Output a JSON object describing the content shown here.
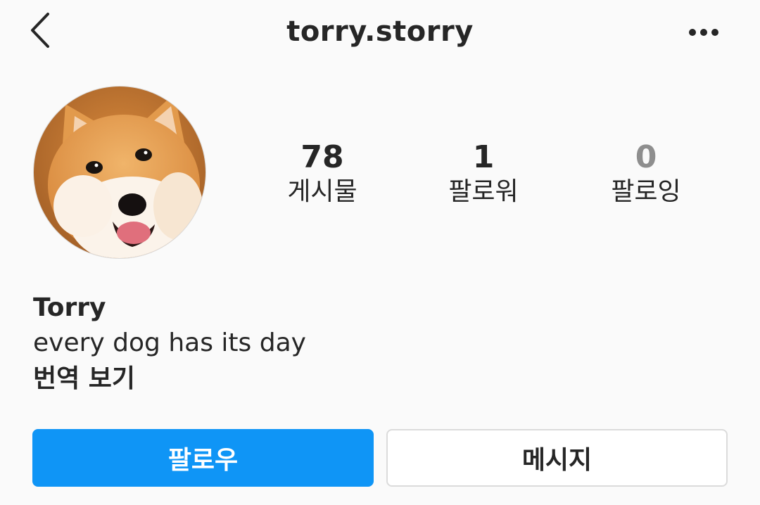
{
  "header": {
    "username": "torry.storry",
    "back_icon": "chevron-left-icon",
    "more_icon": "more-horizontal-icon"
  },
  "profile": {
    "avatar_description": "shiba-inu-dog-photo",
    "stats": {
      "posts": {
        "count": "78",
        "label": "게시물"
      },
      "followers": {
        "count": "1",
        "label": "팔로워"
      },
      "following": {
        "count": "0",
        "label": "팔로잉"
      }
    },
    "name": "Torry",
    "bio": "every dog has its day",
    "translate_label": "번역 보기"
  },
  "actions": {
    "follow_label": "팔로우",
    "message_label": "메시지"
  },
  "colors": {
    "background": "#fafafa",
    "primary_blue": "#0f95f6",
    "text": "#262626",
    "muted": "#8e8e8e",
    "border": "#dbdbdb"
  }
}
